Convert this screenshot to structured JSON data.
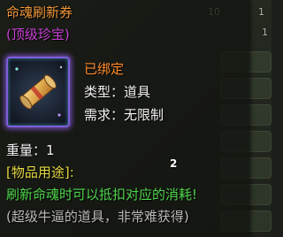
{
  "background": {
    "numbers": [
      "10",
      "1",
      "1"
    ],
    "panel_count": 7
  },
  "item": {
    "name": "命魂刷新券",
    "grade": "(顶级珍宝)",
    "icon": "scroll-icon",
    "bound_status": "已绑定",
    "type_label": "类型：",
    "type_value": "道具",
    "requirement_label": "需求：",
    "requirement_value": "无限制",
    "weight_label": "重量：",
    "weight_value": "1",
    "usage_heading": "[物品用途]:",
    "usage_text": "刷新命魂时可以抵扣对应的消耗!",
    "flavor_text": "(超级牛逼的道具，非常难获得)",
    "stack_count": "2"
  },
  "colors": {
    "name": "#f39a3c",
    "grade": "#c640d4",
    "bound": "#ff8a2a",
    "usage_heading": "#e7da42",
    "usage_text": "#4fd64c",
    "flavor": "#b9b9b9"
  }
}
